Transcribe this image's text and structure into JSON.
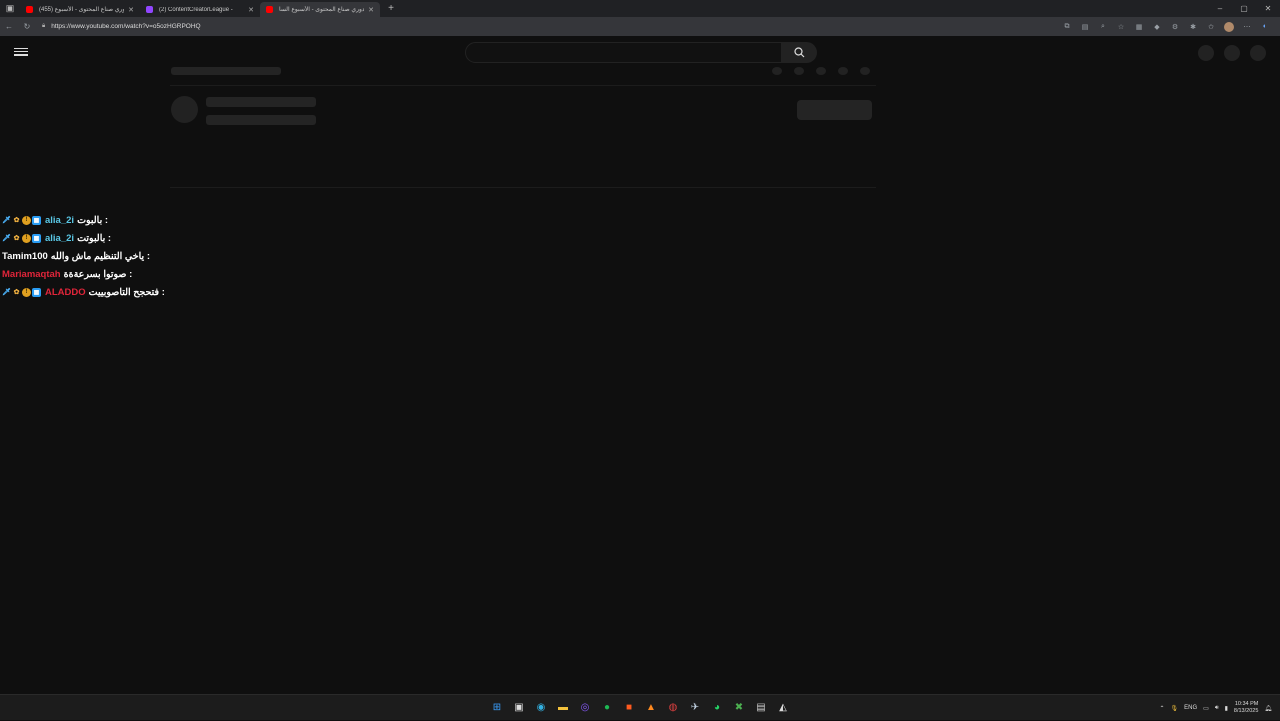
{
  "browser": {
    "tabs": [
      {
        "title": "(455) دوري صناع المحتوى - الأسبوع",
        "favicon_color": "#ff0000",
        "active": false
      },
      {
        "title": "(2) ContentCreatorLeague -",
        "favicon_color": "#9146ff",
        "active": false
      },
      {
        "title": "دوري صناع المحتوى - الأسبوع السا",
        "favicon_color": "#ff0000",
        "active": true
      }
    ],
    "new_tab_label": "+",
    "url": "https://www.youtube.com/watch?v=o5ozHGRPOHQ"
  },
  "chat": {
    "lines": [
      {
        "user": "alia_2i",
        "user_color": "#5ac8e6",
        "message": ": بالبوت",
        "badges": true
      },
      {
        "user": "alia_2i",
        "user_color": "#5ac8e6",
        "message": ": بالبوتت",
        "badges": true
      },
      {
        "user": "Tamim100",
        "user_color": "#ffffff",
        "message": ": ياخي التنظيم ماش والله",
        "badges": false
      },
      {
        "user": "Mariamaqtah",
        "user_color": "#e0253a",
        "message": ": صوتوا بسرعةةة",
        "badges": false
      },
      {
        "user": "ALADDO",
        "user_color": "#e0253a",
        "message": ": فتحجح التاصوبييت",
        "badges": true
      }
    ]
  },
  "taskbar": {
    "language": "ENG",
    "time": "10:34 PM",
    "date": "8/13/2025"
  },
  "colors": {
    "page_bg": "#0f0f0f",
    "skeleton": "#242424",
    "taskbar_bg": "#1c1c1c"
  }
}
